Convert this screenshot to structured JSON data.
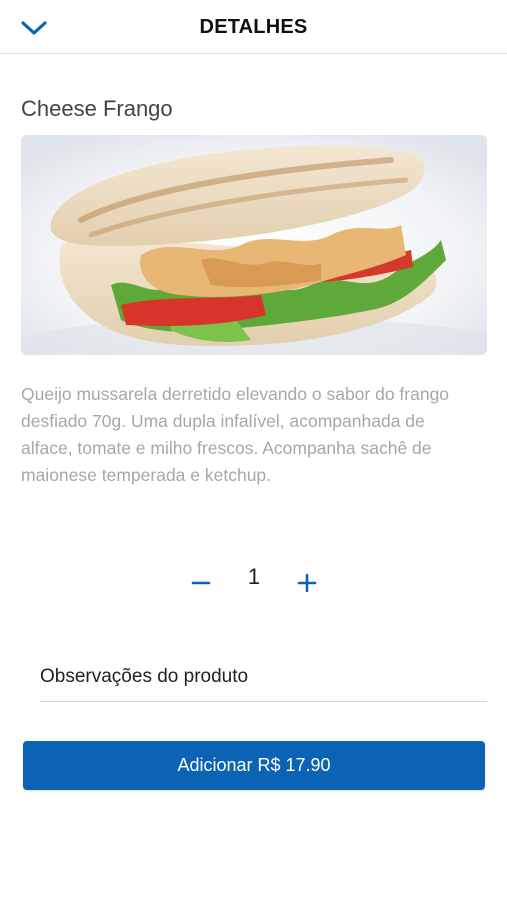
{
  "header": {
    "title": "DETALHES",
    "back_icon": "chevron-down-icon"
  },
  "product": {
    "name": "Cheese Frango",
    "description": "Queijo mussarela derretido elevando o sabor do frango desfiado 70g. Uma dupla infalível, acompanhada de alface, tomate e milho frescos. Acompanha sachê de maionese temperada e ketchup."
  },
  "quantity": {
    "value": "1",
    "minus_icon": "minus-icon",
    "plus_icon": "plus-icon"
  },
  "notes": {
    "placeholder": "Observações do produto",
    "value": ""
  },
  "add_button": {
    "label": "Adicionar R$ 17.90"
  },
  "colors": {
    "accent": "#0b63b5",
    "description_text": "#a7a7a7"
  }
}
